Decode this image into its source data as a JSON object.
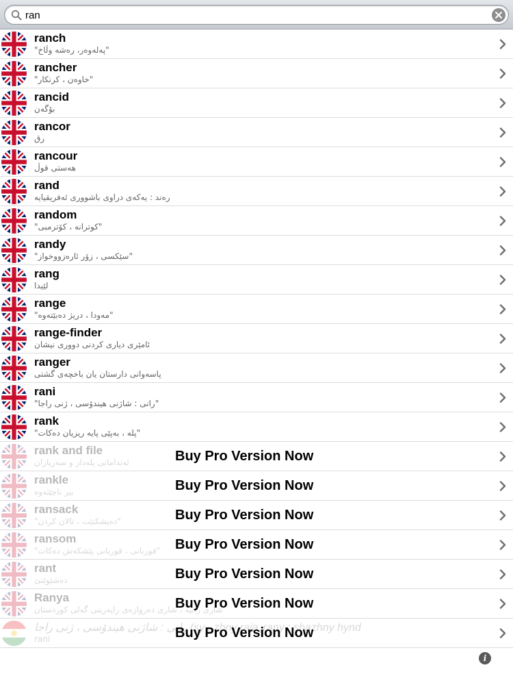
{
  "search": {
    "query": "ran"
  },
  "entries": [
    {
      "word": "ranch",
      "translation": "\"پەلەوەر، رەشە وڵاخ\"",
      "flag": "uk-flag-icon",
      "locked": false
    },
    {
      "word": "rancher",
      "translation": "\"خاوەن ، کرنکار\"",
      "flag": "uk-flag-icon",
      "locked": false
    },
    {
      "word": "rancid",
      "translation": "بۆگەن",
      "flag": "uk-flag-icon",
      "locked": false
    },
    {
      "word": "rancor",
      "translation": "رق",
      "flag": "uk-flag-icon",
      "locked": false
    },
    {
      "word": "rancour",
      "translation": "هەستی قوڵ",
      "flag": "uk-flag-icon",
      "locked": false
    },
    {
      "word": "rand",
      "translation": "رەند : یەکەی دراوی باشووری ئەفریقیایە",
      "flag": "uk-flag-icon",
      "locked": false
    },
    {
      "word": "random",
      "translation": "\"کوترانە ، کۆترمبی\"",
      "flag": "uk-flag-icon",
      "locked": false
    },
    {
      "word": "randy",
      "translation": "\"سێکسی ، زۆر ئارەزووخواز\"",
      "flag": "uk-flag-icon",
      "locked": false
    },
    {
      "word": "rang",
      "translation": "لێیدا",
      "flag": "uk-flag-icon",
      "locked": false
    },
    {
      "word": "range",
      "translation": "\"مەودا ، دریژ دەبێتەوە\"",
      "flag": "uk-flag-icon",
      "locked": false
    },
    {
      "word": "range-finder",
      "translation": "ئامێری دیاری کردنی دووری نیشان",
      "flag": "uk-flag-icon",
      "locked": false
    },
    {
      "word": "ranger",
      "translation": "پاسەوانی دارستان یان باخچەی گشتی",
      "flag": "uk-flag-icon",
      "locked": false
    },
    {
      "word": "rani",
      "translation": "\"رانی : شاژنی هیندۆسی ، ژنی راجا\"",
      "flag": "uk-flag-icon",
      "locked": false
    },
    {
      "word": "rank",
      "translation": "\"پلە ، بەپێی پایە ریزیان دەکات\"",
      "flag": "uk-flag-icon",
      "locked": false
    },
    {
      "word": "rank and file",
      "translation": "ئەندامانی پلەدار و سەربازان",
      "flag": "uk-flag-icon",
      "locked": true,
      "promo": "Buy Pro Version Now"
    },
    {
      "word": "rankle",
      "translation": "بیر ناچێتەوە",
      "flag": "uk-flag-icon",
      "locked": true,
      "promo": "Buy Pro Version Now"
    },
    {
      "word": "ransack",
      "translation": "\"دەپشکنێت ، تالان کردن\"",
      "flag": "uk-flag-icon",
      "locked": true,
      "promo": "Buy Pro Version Now"
    },
    {
      "word": "ransom",
      "translation": "\"قوربانی ، قوربانی پێشکەش دەکات\"",
      "flag": "uk-flag-icon",
      "locked": true,
      "promo": "Buy Pro Version Now"
    },
    {
      "word": "rant",
      "translation": "دەشێوێنێ",
      "flag": "uk-flag-icon",
      "locked": true,
      "promo": "Buy Pro Version Now"
    },
    {
      "word": "Ranya",
      "translation": "شاری رانیە ، شاری دەروازەی راپەرینی گەلی کوردستان",
      "flag": "uk-flag-icon",
      "locked": true,
      "promo": "Buy Pro Version Now"
    },
    {
      "word": "رانی : شاژنی هیندۆسی ، ژنی راجا (sy , zhny rajaډrany : shazhny hynd",
      "translation": "rani",
      "flag": "kurdistan-flag-icon",
      "locked": true,
      "promo": "Buy Pro Version Now",
      "kurdish": true
    }
  ]
}
